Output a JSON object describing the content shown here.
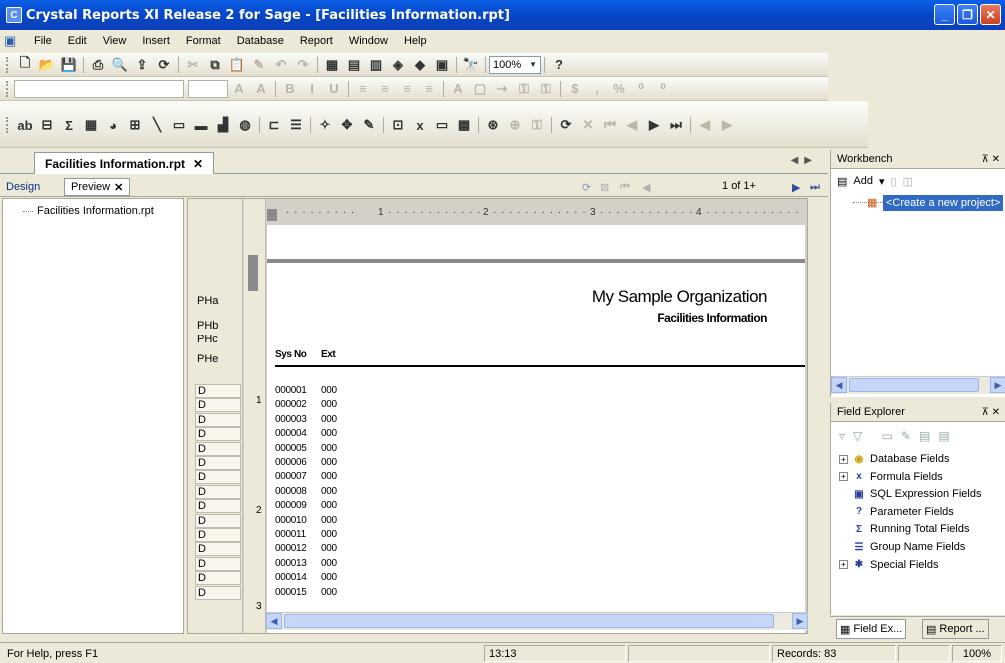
{
  "window": {
    "title": "Crystal Reports XI Release 2 for Sage - [Facilities Information.rpt]"
  },
  "menu": [
    "File",
    "Edit",
    "View",
    "Insert",
    "Format",
    "Database",
    "Report",
    "Window",
    "Help"
  ],
  "toolbar": {
    "zoom": "100%"
  },
  "doc_tab": {
    "label": "Facilities Information.rpt"
  },
  "view_tabs": {
    "design": "Design",
    "preview": "Preview"
  },
  "navigation": {
    "page_info": "1 of 1+"
  },
  "tree": {
    "item": "Facilities Information.rpt"
  },
  "sections": [
    "PHa",
    "PHb",
    "PHc",
    "PHe"
  ],
  "detail_label": "D",
  "report": {
    "org": "My Sample Organization",
    "subtitle": "Facilities Information",
    "headers": {
      "sys_no": "Sys No",
      "ext": "Ext"
    },
    "rows": [
      {
        "sys_no": "000001",
        "ext": "000"
      },
      {
        "sys_no": "000002",
        "ext": "000"
      },
      {
        "sys_no": "000003",
        "ext": "000"
      },
      {
        "sys_no": "000004",
        "ext": "000"
      },
      {
        "sys_no": "000005",
        "ext": "000"
      },
      {
        "sys_no": "000006",
        "ext": "000"
      },
      {
        "sys_no": "000007",
        "ext": "000"
      },
      {
        "sys_no": "000008",
        "ext": "000"
      },
      {
        "sys_no": "000009",
        "ext": "000"
      },
      {
        "sys_no": "000010",
        "ext": "000"
      },
      {
        "sys_no": "000011",
        "ext": "000"
      },
      {
        "sys_no": "000012",
        "ext": "000"
      },
      {
        "sys_no": "000013",
        "ext": "000"
      },
      {
        "sys_no": "000014",
        "ext": "000"
      },
      {
        "sys_no": "000015",
        "ext": "000"
      }
    ]
  },
  "ruler_marks": [
    "1",
    "2",
    "3",
    "4"
  ],
  "vruler_marks": [
    "1",
    "2",
    "3"
  ],
  "workbench": {
    "title": "Workbench",
    "add_label": "Add",
    "create_project": "<Create a new project>"
  },
  "field_explorer": {
    "title": "Field Explorer",
    "items": [
      {
        "label": "Database Fields",
        "icon": "database-icon",
        "expandable": true
      },
      {
        "label": "Formula Fields",
        "icon": "formula-icon",
        "expandable": true
      },
      {
        "label": "SQL Expression Fields",
        "icon": "sql-icon",
        "expandable": false
      },
      {
        "label": "Parameter Fields",
        "icon": "parameter-icon",
        "expandable": false
      },
      {
        "label": "Running Total Fields",
        "icon": "sigma-icon",
        "expandable": false
      },
      {
        "label": "Group Name Fields",
        "icon": "group-icon",
        "expandable": false
      },
      {
        "label": "Special Fields",
        "icon": "special-icon",
        "expandable": true
      }
    ]
  },
  "bottom_tabs": [
    "Field Ex...",
    "Report ..."
  ],
  "status": {
    "help": "For Help, press F1",
    "time": "13:13",
    "records": "Records: 83",
    "zoom": "100%"
  }
}
